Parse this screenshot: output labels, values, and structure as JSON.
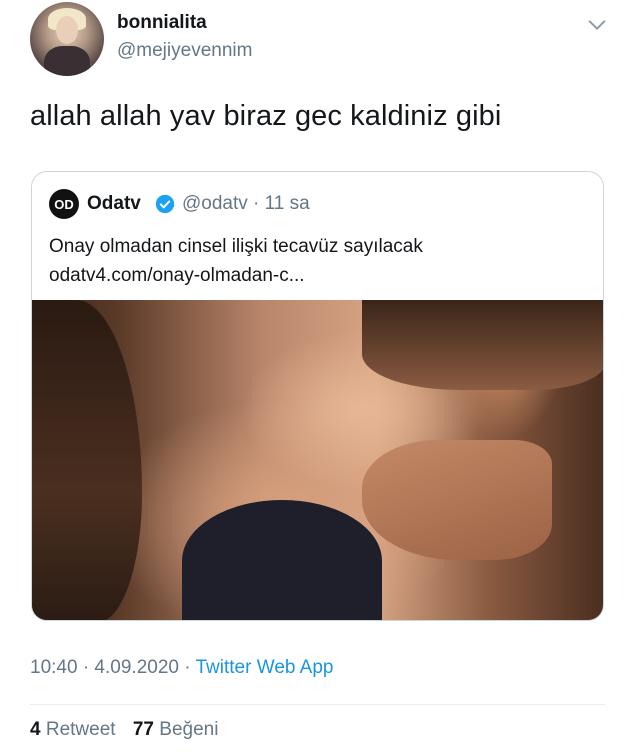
{
  "author": {
    "display_name": "bonnialita",
    "handle": "@mejiyevennim",
    "avatar_icon": "user-avatar"
  },
  "tweet": {
    "text": "allah allah yav biraz gec kaldiniz gibi"
  },
  "quoted": {
    "avatar_label": "OD",
    "name": "Odatv",
    "handle_time": "@odatv · 11 sa",
    "text": "Onay olmadan cinsel ilişki tecavüz sayılacak",
    "link": "odatv4.com/onay-olmadan-c...",
    "verified_color": "#1da1f2"
  },
  "meta": {
    "time": "10:40 · 4.09.2020 · ",
    "source": "Twitter Web App"
  },
  "stats": {
    "retweets": "4",
    "retweets_label": "Retweet",
    "likes": "77",
    "likes_label": "Beğeni"
  },
  "colors": {
    "link_blue": "#1b95e0",
    "secondary_text": "#657786"
  }
}
